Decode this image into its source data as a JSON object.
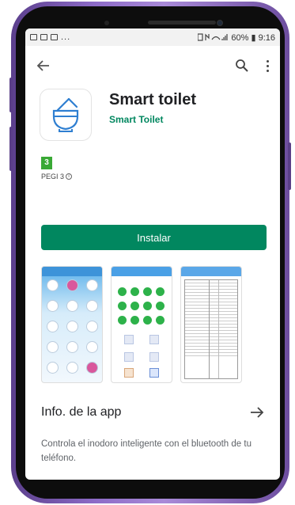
{
  "status_bar": {
    "right_text": "60% ▮ 9:16",
    "left_dots": "..."
  },
  "app": {
    "title": "Smart toilet",
    "developer": "Smart Toilet",
    "pegi_badge": "3",
    "pegi_label": "PEGI 3",
    "install_label": "Instalar",
    "accent_color": "#01875f"
  },
  "info": {
    "title": "Info. de la app",
    "description": "Controla el inodoro inteligente con el bluetooth de tu teléfono."
  },
  "icons": [
    "back-arrow-icon",
    "search-icon",
    "more-vert-icon",
    "app-icon",
    "arrow-right-icon",
    "info-icon"
  ]
}
